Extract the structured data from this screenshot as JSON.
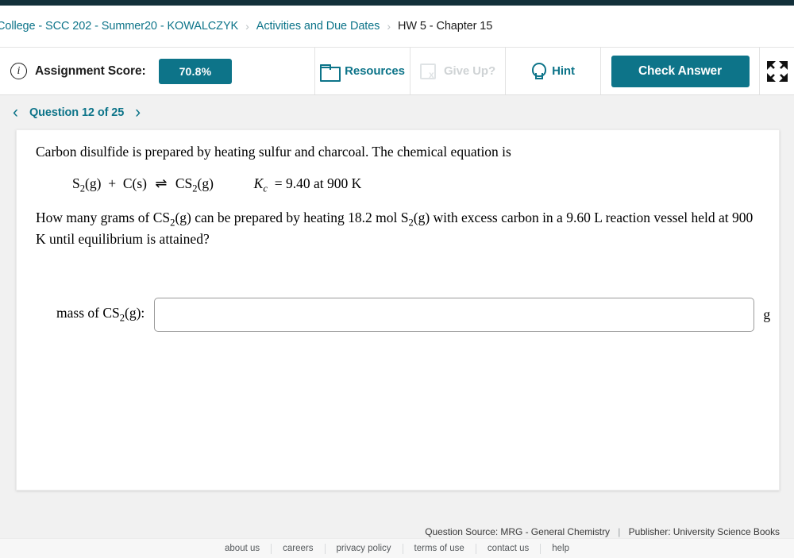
{
  "breadcrumb": {
    "items": [
      {
        "label": "College - SCC 202 - Summer20 - KOWALCZYK",
        "current": false
      },
      {
        "label": "Activities and Due Dates",
        "current": false
      },
      {
        "label": "HW 5 - Chapter 15",
        "current": true
      }
    ],
    "separator": "›"
  },
  "toolbar": {
    "info_icon_glyph": "i",
    "score_label": "Assignment Score:",
    "score_value": "70.8%",
    "resources_label": "Resources",
    "giveup_label": "Give Up?",
    "hint_label": "Hint",
    "check_answer_label": "Check Answer",
    "expand_icon": "fullscreen-expand-icon"
  },
  "question_nav": {
    "prev_glyph": "‹",
    "next_glyph": "›",
    "label": "Question 12 of 25"
  },
  "question": {
    "intro": "Carbon disulfide is prepared by heating sulfur and charcoal. The chemical equation is",
    "equation": {
      "reactant_1": "S",
      "reactant_1_sub": "2",
      "reactant_1_state": "(g)",
      "plus": "+",
      "reactant_2": "C",
      "reactant_2_state": "(s)",
      "arrow": "⇌",
      "product": "CS",
      "product_sub": "2",
      "product_state": "(g)",
      "kc_symbol": "K",
      "kc_sub": "c",
      "kc_value": "= 9.40 at 900 K"
    },
    "prompt_part_1": "How many grams of CS",
    "prompt_sub_1": "2",
    "prompt_part_2": "(g) can be prepared by heating 18.2 mol S",
    "prompt_sub_2": "2",
    "prompt_part_3": "(g) with excess carbon in a 9.60 L reaction vessel held at 900 K until equilibrium is attained?",
    "answer_label_part_1": "mass of CS",
    "answer_label_sub": "2",
    "answer_label_part_2": "(g):",
    "answer_value": "",
    "answer_placeholder": "",
    "answer_unit": "g"
  },
  "source": {
    "question_source": "Question Source: MRG - General Chemistry",
    "separator": "|",
    "publisher": "Publisher: University Science Books"
  },
  "footer": {
    "links": [
      "about us",
      "careers",
      "privacy policy",
      "terms of use",
      "contact us",
      "help"
    ]
  },
  "colors": {
    "accent_teal": "#0d7489",
    "topbar_navy": "#12303a",
    "page_background": "#f1f1f1",
    "disabled_gray": "#cfd3d5"
  }
}
